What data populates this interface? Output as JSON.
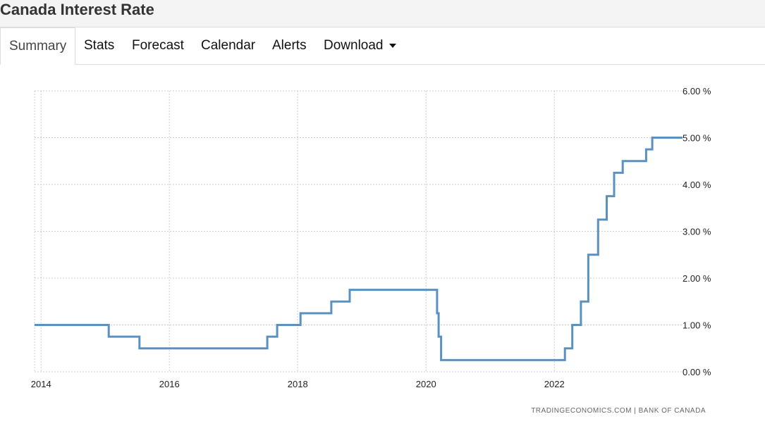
{
  "page": {
    "title": "Canada Interest Rate"
  },
  "tabs": [
    {
      "label": "Summary",
      "active": true
    },
    {
      "label": "Stats"
    },
    {
      "label": "Forecast"
    },
    {
      "label": "Calendar"
    },
    {
      "label": "Alerts"
    },
    {
      "label": "Download"
    }
  ],
  "chart_data": {
    "type": "line",
    "line_style": "step",
    "x_axis": {
      "type": "date",
      "range": [
        "2013-11-25",
        "2023-12-31"
      ],
      "tick_labels": [
        "2014",
        "2016",
        "2018",
        "2020",
        "2022"
      ]
    },
    "y_axis": {
      "position": "right",
      "range": [
        0,
        6
      ],
      "tick_labels": [
        "0.00 %",
        "1.00 %",
        "2.00 %",
        "3.00 %",
        "4.00 %",
        "5.00 %",
        "6.00 %"
      ]
    },
    "grid": true,
    "series": [
      {
        "color": "#5b91c0",
        "points": [
          [
            "2013-11-25",
            1.0
          ],
          [
            "2015-01-21",
            0.75
          ],
          [
            "2015-07-15",
            0.5
          ],
          [
            "2017-07-12",
            0.75
          ],
          [
            "2017-09-06",
            1.0
          ],
          [
            "2018-01-17",
            1.25
          ],
          [
            "2018-07-11",
            1.5
          ],
          [
            "2018-10-24",
            1.75
          ],
          [
            "2020-03-04",
            1.25
          ],
          [
            "2020-03-13",
            0.75
          ],
          [
            "2020-03-27",
            0.25
          ],
          [
            "2022-03-02",
            0.5
          ],
          [
            "2022-04-13",
            1.0
          ],
          [
            "2022-06-01",
            1.5
          ],
          [
            "2022-07-13",
            2.5
          ],
          [
            "2022-09-07",
            3.25
          ],
          [
            "2022-10-26",
            3.75
          ],
          [
            "2022-12-07",
            4.25
          ],
          [
            "2023-01-25",
            4.5
          ],
          [
            "2023-06-07",
            4.75
          ],
          [
            "2023-07-12",
            5.0
          ],
          [
            "2023-12-31",
            5.0
          ]
        ]
      }
    ],
    "source": "TRADINGECONOMICS.COM | BANK OF CANADA"
  }
}
